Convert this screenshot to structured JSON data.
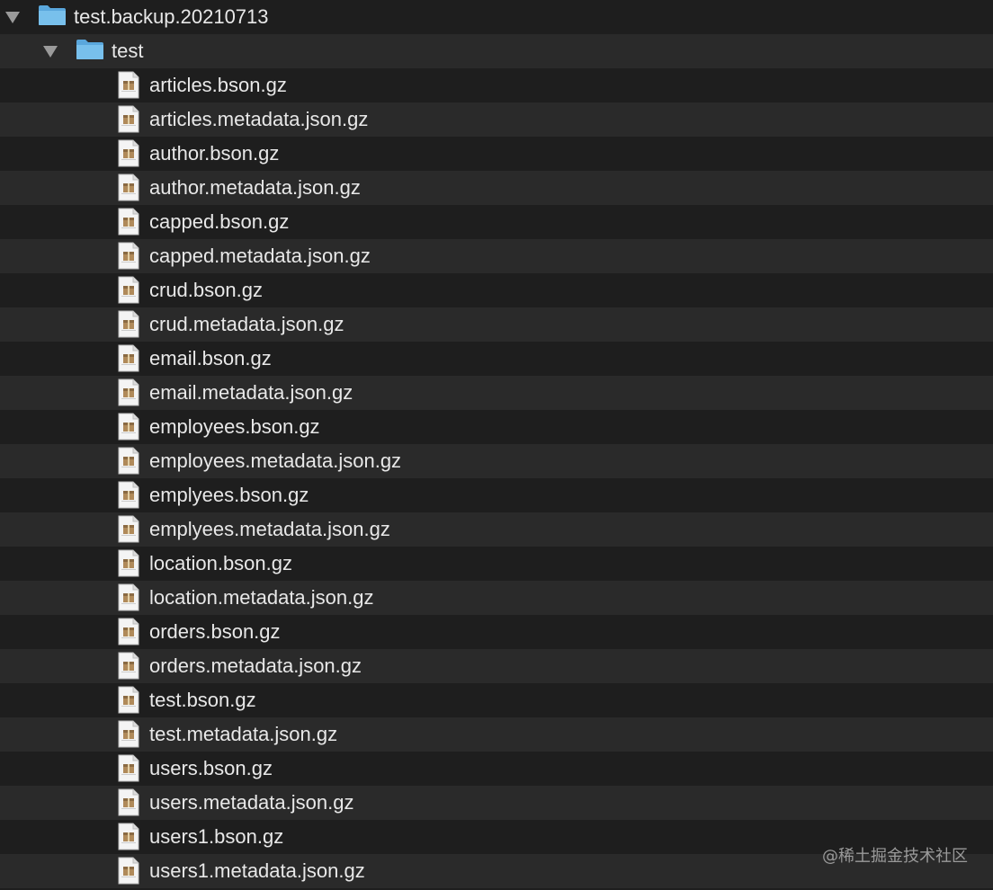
{
  "tree": {
    "root": {
      "label": "test.backup.20210713",
      "icon": "folder-icon",
      "expanded": true
    },
    "child_folder": {
      "label": "test",
      "icon": "folder-icon",
      "expanded": true
    },
    "files": [
      "articles.bson.gz",
      "articles.metadata.json.gz",
      "author.bson.gz",
      "author.metadata.json.gz",
      "capped.bson.gz",
      "capped.metadata.json.gz",
      "crud.bson.gz",
      "crud.metadata.json.gz",
      "email.bson.gz",
      "email.metadata.json.gz",
      "employees.bson.gz",
      "employees.metadata.json.gz",
      "emplyees.bson.gz",
      "emplyees.metadata.json.gz",
      "location.bson.gz",
      "location.metadata.json.gz",
      "orders.bson.gz",
      "orders.metadata.json.gz",
      "test.bson.gz",
      "test.metadata.json.gz",
      "users.bson.gz",
      "users.metadata.json.gz",
      "users1.bson.gz",
      "users1.metadata.json.gz"
    ]
  },
  "watermark": "@稀土掘金技术社区",
  "colors": {
    "folder": "#6cb6e6",
    "row_alt": "#2a2a2a",
    "background": "#1e1e1e",
    "text": "#e8e8e8"
  }
}
